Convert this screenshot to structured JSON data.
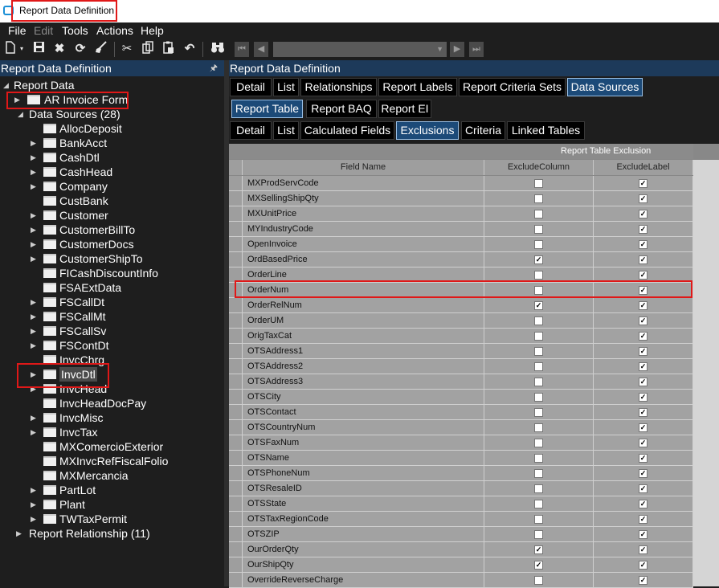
{
  "window": {
    "title": "Report Data Definition"
  },
  "menu": [
    "File",
    "Edit",
    "Tools",
    "Actions",
    "Help"
  ],
  "toolbar_icons": [
    "new-icon",
    "save-icon",
    "delete-icon",
    "refresh-icon",
    "clear-icon",
    "cut-icon",
    "copy-icon",
    "paste-icon",
    "undo-icon",
    "binoculars-icon",
    "first-icon",
    "prev-icon",
    "next-icon",
    "last-icon"
  ],
  "left_panel": {
    "title": "Report Data Definition",
    "tree": {
      "root": "Report Data",
      "form": "AR Invoice Form",
      "data_sources_label": "Data Sources (28)",
      "data_sources": [
        {
          "name": "AllocDeposit",
          "expandable": false
        },
        {
          "name": "BankAcct",
          "expandable": true
        },
        {
          "name": "CashDtl",
          "expandable": true
        },
        {
          "name": "CashHead",
          "expandable": true
        },
        {
          "name": "Company",
          "expandable": true
        },
        {
          "name": "CustBank",
          "expandable": false
        },
        {
          "name": "Customer",
          "expandable": true
        },
        {
          "name": "CustomerBillTo",
          "expandable": true
        },
        {
          "name": "CustomerDocs",
          "expandable": true
        },
        {
          "name": "CustomerShipTo",
          "expandable": true
        },
        {
          "name": "FICashDiscountInfo",
          "expandable": false
        },
        {
          "name": "FSAExtData",
          "expandable": false
        },
        {
          "name": "FSCallDt",
          "expandable": true
        },
        {
          "name": "FSCallMt",
          "expandable": true
        },
        {
          "name": "FSCallSv",
          "expandable": true
        },
        {
          "name": "FSContDt",
          "expandable": true
        },
        {
          "name": "InvcChrg",
          "expandable": false
        },
        {
          "name": "InvcDtl",
          "expandable": true,
          "selected": true
        },
        {
          "name": "InvcHead",
          "expandable": true
        },
        {
          "name": "InvcHeadDocPay",
          "expandable": false
        },
        {
          "name": "InvcMisc",
          "expandable": true
        },
        {
          "name": "InvcTax",
          "expandable": true
        },
        {
          "name": "MXComercioExterior",
          "expandable": false
        },
        {
          "name": "MXInvcRefFiscalFolio",
          "expandable": false
        },
        {
          "name": "MXMercancia",
          "expandable": false
        },
        {
          "name": "PartLot",
          "expandable": true
        },
        {
          "name": "Plant",
          "expandable": true
        },
        {
          "name": "TWTaxPermit",
          "expandable": true
        }
      ],
      "relationship_label": "Report Relationship (11)"
    }
  },
  "right_panel": {
    "title": "Report Data Definition",
    "tabs_level1": [
      "Detail",
      "List",
      "Relationships",
      "Report Labels",
      "Report Criteria Sets",
      "Data Sources"
    ],
    "tabs_level2": [
      "Report Table",
      "Report BAQ",
      "Report EI"
    ],
    "tabs_level3": [
      "Detail",
      "List",
      "Calculated Fields",
      "Exclusions",
      "Criteria",
      "Linked Tables"
    ],
    "grid": {
      "group_header": "Report Table Exclusion",
      "columns": [
        "Field Name",
        "ExcludeColumn",
        "ExcludeLabel"
      ],
      "rows": [
        {
          "field": "MXProdServCode",
          "exclude_column": false,
          "exclude_label": true
        },
        {
          "field": "MXSellingShipQty",
          "exclude_column": false,
          "exclude_label": true
        },
        {
          "field": "MXUnitPrice",
          "exclude_column": false,
          "exclude_label": true
        },
        {
          "field": "MYIndustryCode",
          "exclude_column": false,
          "exclude_label": true
        },
        {
          "field": "OpenInvoice",
          "exclude_column": false,
          "exclude_label": true
        },
        {
          "field": "OrdBasedPrice",
          "exclude_column": true,
          "exclude_label": true
        },
        {
          "field": "OrderLine",
          "exclude_column": false,
          "exclude_label": true
        },
        {
          "field": "OrderNum",
          "exclude_column": false,
          "exclude_label": true
        },
        {
          "field": "OrderRelNum",
          "exclude_column": true,
          "exclude_label": true
        },
        {
          "field": "OrderUM",
          "exclude_column": false,
          "exclude_label": true
        },
        {
          "field": "OrigTaxCat",
          "exclude_column": false,
          "exclude_label": true
        },
        {
          "field": "OTSAddress1",
          "exclude_column": false,
          "exclude_label": true
        },
        {
          "field": "OTSAddress2",
          "exclude_column": false,
          "exclude_label": true
        },
        {
          "field": "OTSAddress3",
          "exclude_column": false,
          "exclude_label": true
        },
        {
          "field": "OTSCity",
          "exclude_column": false,
          "exclude_label": true
        },
        {
          "field": "OTSContact",
          "exclude_column": false,
          "exclude_label": true
        },
        {
          "field": "OTSCountryNum",
          "exclude_column": false,
          "exclude_label": true
        },
        {
          "field": "OTSFaxNum",
          "exclude_column": false,
          "exclude_label": true
        },
        {
          "field": "OTSName",
          "exclude_column": false,
          "exclude_label": true
        },
        {
          "field": "OTSPhoneNum",
          "exclude_column": false,
          "exclude_label": true
        },
        {
          "field": "OTSResaleID",
          "exclude_column": false,
          "exclude_label": true
        },
        {
          "field": "OTSState",
          "exclude_column": false,
          "exclude_label": true
        },
        {
          "field": "OTSTaxRegionCode",
          "exclude_column": false,
          "exclude_label": true
        },
        {
          "field": "OTSZIP",
          "exclude_column": false,
          "exclude_label": true
        },
        {
          "field": "OurOrderQty",
          "exclude_column": true,
          "exclude_label": true
        },
        {
          "field": "OurShipQty",
          "exclude_column": true,
          "exclude_label": true
        },
        {
          "field": "OverrideReverseCharge",
          "exclude_column": false,
          "exclude_label": true
        }
      ]
    }
  },
  "colors": {
    "panel_header": "#1d3a5a",
    "active_tab": "#1c4a78",
    "highlight": "#e01818"
  }
}
